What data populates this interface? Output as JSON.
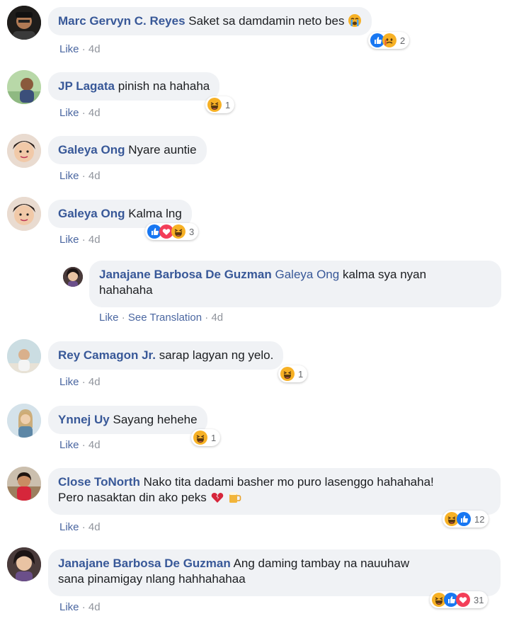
{
  "comments": [
    {
      "author": "Marc Gervyn C. Reyes",
      "text": "Saket sa damdamin neto bes",
      "like": "Like",
      "time": "4d",
      "reaction_count": "2"
    },
    {
      "author": "JP Lagata",
      "text": "pinish na hahaha",
      "like": "Like",
      "time": "4d",
      "reaction_count": "1"
    },
    {
      "author": "Galeya Ong",
      "text": "Nyare auntie",
      "like": "Like",
      "time": "4d"
    },
    {
      "author": "Galeya Ong",
      "text": "Kalma lng",
      "like": "Like",
      "time": "4d",
      "reaction_count": "3"
    },
    {
      "author": "Janajane Barbosa De Guzman",
      "mention": "Galeya Ong",
      "text_line1": "kalma sya nyan",
      "text_line2": "hahahaha",
      "like": "Like",
      "translate": "See Translation",
      "time": "4d"
    },
    {
      "author": "Rey Camagon Jr.",
      "text": "sarap lagyan ng yelo.",
      "like": "Like",
      "time": "4d",
      "reaction_count": "1"
    },
    {
      "author": "Ynnej Uy",
      "text": "Sayang hehehe",
      "like": "Like",
      "time": "4d",
      "reaction_count": "1"
    },
    {
      "author": "Close ToNorth",
      "text_line1": "Nako tita dadami basher mo puro lasenggo hahahaha!",
      "text_line2": "Pero nasaktan din ako peks",
      "like": "Like",
      "time": "4d",
      "reaction_count": "12"
    },
    {
      "author": "Janajane Barbosa De Guzman",
      "text_line1": "Ang daming tambay na nauuhaw",
      "text_line2": "sana pinamigay nlang hahhahahaa",
      "like": "Like",
      "time": "4d",
      "reaction_count": "31"
    }
  ],
  "separator": "·",
  "colors": {
    "link": "#385898",
    "bubble": "#f0f2f5",
    "meta": "#90949c",
    "like_blue": "#1877f2",
    "love_red": "#f33e58",
    "haha_yellow": "#f7b125"
  }
}
